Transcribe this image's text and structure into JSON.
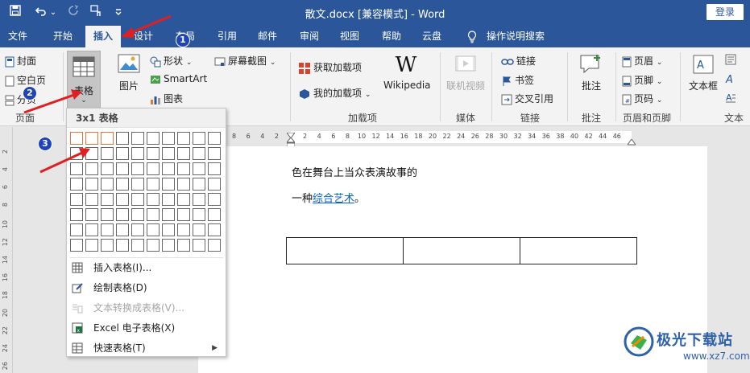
{
  "window": {
    "title": "散文.docx [兼容模式]  -  Word",
    "login_label": "登录"
  },
  "quick_access": {
    "save_icon": "save-icon",
    "undo_icon": "undo-icon",
    "redo_icon": "redo-icon",
    "touch_mode_icon": "touch-mode-icon",
    "customize_icon": "customize-icon",
    "dropdown_glyph": "⌄"
  },
  "tabs": [
    "文件",
    "开始",
    "插入",
    "设计",
    "布局",
    "引用",
    "邮件",
    "审阅",
    "视图",
    "帮助",
    "云盘"
  ],
  "tell_me": "操作说明搜索",
  "ribbon": {
    "pages": {
      "cover": "封面",
      "blank": "空白页",
      "break": "分页",
      "label": "页面"
    },
    "table": {
      "label": "表格",
      "group": "表格"
    },
    "illustrations": {
      "picture": "图片",
      "shapes": "形状",
      "smartart": "SmartArt",
      "chart": "图表",
      "screenshot": "屏幕截图"
    },
    "addins": {
      "get": "获取加载项",
      "mine": "我的加载项",
      "wikipedia": "Wikipedia",
      "label": "加载项"
    },
    "media": {
      "online_video": "联机视频",
      "label": "媒体"
    },
    "links": {
      "link": "链接",
      "bookmark": "书签",
      "cross_ref": "交叉引用",
      "label": "链接"
    },
    "comments": {
      "comment": "批注",
      "label": "批注"
    },
    "header_footer": {
      "header": "页眉",
      "footer": "页脚",
      "page_number": "页码",
      "label": "页眉和页脚"
    },
    "text": {
      "textbox": "文本框",
      "label": "文本"
    }
  },
  "table_menu": {
    "grid_title": "3x1 表格",
    "grid_rows": 8,
    "grid_cols": 10,
    "selected_cols": 3,
    "selected_rows": 1,
    "items": [
      {
        "label": "插入表格(I)...",
        "icon": "insert-table-icon",
        "enabled": true
      },
      {
        "label": "绘制表格(D)",
        "icon": "draw-table-icon",
        "enabled": true
      },
      {
        "label": "文本转换成表格(V)...",
        "icon": "text-to-table-icon",
        "enabled": false
      },
      {
        "label": "Excel 电子表格(X)",
        "icon": "excel-icon",
        "enabled": true
      },
      {
        "label": "快速表格(T)",
        "icon": "quick-tables-icon",
        "enabled": true,
        "submenu": true
      }
    ]
  },
  "ruler": {
    "left_numbers": [
      "8",
      "6",
      "4",
      "2"
    ],
    "right_numbers": [
      "2",
      "4",
      "6",
      "8",
      "10",
      "12",
      "14",
      "16",
      "18",
      "20",
      "22",
      "24",
      "26",
      "28",
      "30",
      "32",
      "34",
      "36",
      "38",
      "40",
      "42",
      "44",
      "46"
    ],
    "vertical_numbers": [
      "2",
      "4",
      "6",
      "8",
      "10",
      "12",
      "14",
      "16",
      "18",
      "20",
      "22",
      "24",
      "26"
    ]
  },
  "document": {
    "line1": "色在舞台上当众表演故事的",
    "line2_prefix": "一种",
    "line2_link": "综合艺术",
    "line2_suffix": "。",
    "table_rows": 1,
    "table_cols": 3
  },
  "annotations": {
    "badge1": "1",
    "badge2": "2",
    "badge3": "3"
  },
  "watermark": {
    "brand": "极光下载站",
    "url": "www.xz7.com"
  },
  "colors": {
    "titlebar": "#2b579a",
    "selection": "#e8733a",
    "badge": "#1f43b8",
    "arrow": "#e02020",
    "link": "#0563c1"
  }
}
